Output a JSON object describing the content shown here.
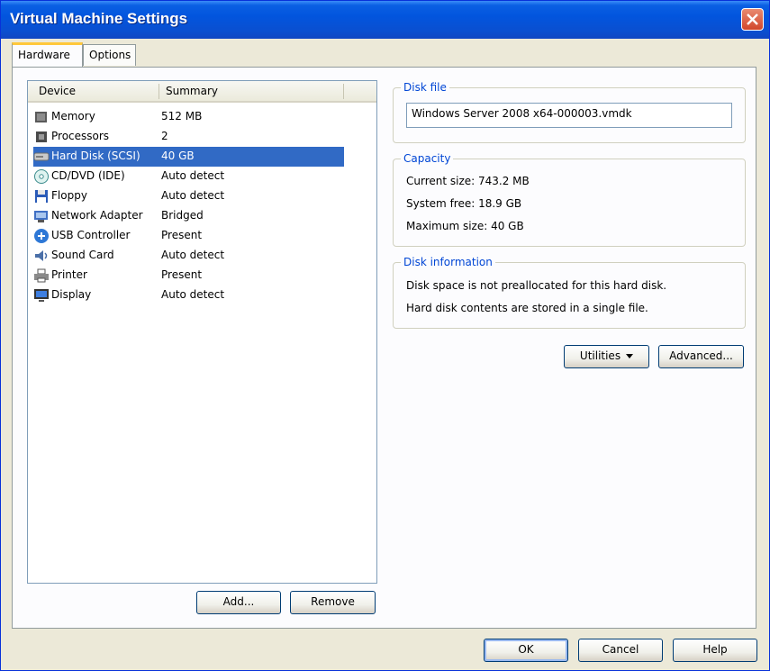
{
  "window": {
    "title": "Virtual Machine Settings"
  },
  "tabs": [
    {
      "label": "Hardware",
      "active": true
    },
    {
      "label": "Options",
      "active": false
    }
  ],
  "device_list": {
    "headers": {
      "device": "Device",
      "summary": "Summary"
    },
    "items": [
      {
        "name": "Memory",
        "summary": "512 MB",
        "icon": "memory-icon"
      },
      {
        "name": "Processors",
        "summary": "2",
        "icon": "processor-icon"
      },
      {
        "name": "Hard Disk (SCSI)",
        "summary": "40 GB",
        "icon": "hard-disk-icon",
        "selected": true
      },
      {
        "name": "CD/DVD (IDE)",
        "summary": "Auto detect",
        "icon": "cd-dvd-icon"
      },
      {
        "name": "Floppy",
        "summary": "Auto detect",
        "icon": "floppy-icon"
      },
      {
        "name": "Network Adapter",
        "summary": "Bridged",
        "icon": "network-adapter-icon"
      },
      {
        "name": "USB Controller",
        "summary": "Present",
        "icon": "usb-icon"
      },
      {
        "name": "Sound Card",
        "summary": "Auto detect",
        "icon": "sound-card-icon"
      },
      {
        "name": "Printer",
        "summary": "Present",
        "icon": "printer-icon"
      },
      {
        "name": "Display",
        "summary": "Auto detect",
        "icon": "display-icon"
      }
    ],
    "add_label": "Add...",
    "remove_label": "Remove"
  },
  "disk_file": {
    "legend": "Disk file",
    "value": "Windows Server 2008 x64-000003.vmdk"
  },
  "capacity": {
    "legend": "Capacity",
    "current": "Current size: 743.2 MB",
    "system_free": "System free: 18.9 GB",
    "maximum": "Maximum size: 40 GB"
  },
  "disk_information": {
    "legend": "Disk information",
    "line1": "Disk space is not preallocated for this hard disk.",
    "line2": "Hard disk contents are stored in a single file."
  },
  "actions": {
    "utilities_label": "Utilities",
    "advanced_label": "Advanced..."
  },
  "footer": {
    "ok_label": "OK",
    "cancel_label": "Cancel",
    "help_label": "Help"
  },
  "colors": {
    "titlebar": "#0255de",
    "selection": "#316ac5",
    "legend_text": "#0046d5",
    "tab_highlight": "#ffc83c"
  }
}
